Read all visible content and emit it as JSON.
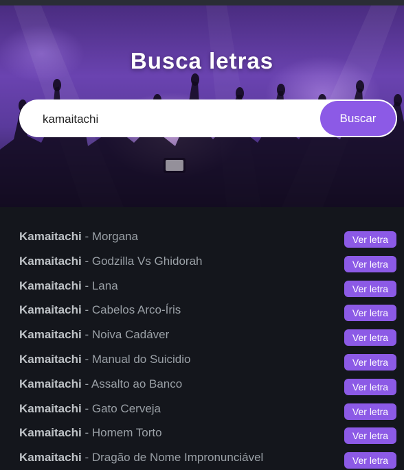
{
  "hero": {
    "title": "Busca letras",
    "search_value": "kamaitachi",
    "search_button": "Buscar"
  },
  "results": [
    {
      "artist": "Kamaitachi",
      "song": "Morgana",
      "action": "Ver letra"
    },
    {
      "artist": "Kamaitachi",
      "song": "Godzilla Vs Ghidorah",
      "action": "Ver letra"
    },
    {
      "artist": "Kamaitachi",
      "song": "Lana",
      "action": "Ver letra"
    },
    {
      "artist": "Kamaitachi",
      "song": "Cabelos Arco-Íris",
      "action": "Ver letra"
    },
    {
      "artist": "Kamaitachi",
      "song": "Noiva Cadáver",
      "action": "Ver letra"
    },
    {
      "artist": "Kamaitachi",
      "song": "Manual do Suicidio",
      "action": "Ver letra"
    },
    {
      "artist": "Kamaitachi",
      "song": "Assalto ao Banco",
      "action": "Ver letra"
    },
    {
      "artist": "Kamaitachi",
      "song": "Gato Cerveja",
      "action": "Ver letra"
    },
    {
      "artist": "Kamaitachi",
      "song": "Homem Torto",
      "action": "Ver letra"
    },
    {
      "artist": "Kamaitachi",
      "song": "Dragão de Nome Impronunciável",
      "action": "Ver letra"
    }
  ],
  "separator": "-",
  "colors": {
    "accent": "#8c5ae6",
    "background": "#14161c",
    "hero_purple": "#6a43b0"
  },
  "icons": {
    "hero_background": "concert-crowd-image"
  }
}
